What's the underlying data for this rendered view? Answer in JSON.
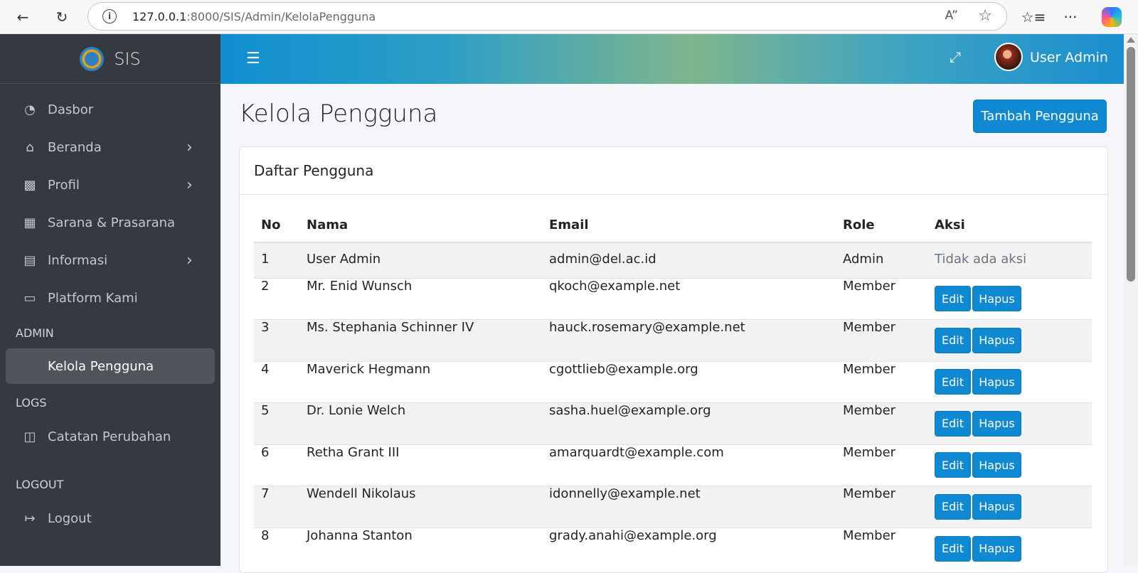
{
  "browser": {
    "url_host": "127.0.0.1",
    "url_path": ":8000/SIS/Admin/KelolaPengguna"
  },
  "sidebar": {
    "brand": "SIS",
    "items": [
      {
        "label": "Dasbor",
        "icon": "gauge-icon"
      },
      {
        "label": "Beranda",
        "icon": "home-icon"
      },
      {
        "label": "Profil",
        "icon": "contact-card-icon"
      },
      {
        "label": "Sarana & Prasarana",
        "icon": "building-icon"
      },
      {
        "label": "Informasi",
        "icon": "document-list-icon"
      },
      {
        "label": "Platform Kami",
        "icon": "monitor-icon"
      }
    ],
    "header_admin": "ADMIN",
    "admin_item": "Kelola Pengguna",
    "header_logs": "LOGS",
    "logs_item": "Catatan Perubahan",
    "header_logout": "LOGOUT",
    "logout_item": "Logout"
  },
  "header": {
    "user_name": "User Admin"
  },
  "page": {
    "title": "Kelola Pengguna",
    "add_button": "Tambah Pengguna",
    "card_title": "Daftar Pengguna"
  },
  "table": {
    "columns": [
      "No",
      "Nama",
      "Email",
      "Role",
      "Aksi"
    ],
    "no_action_text": "Tidak ada aksi",
    "edit_label": "Edit",
    "delete_label": "Hapus",
    "rows": [
      {
        "no": "1",
        "name": "User Admin",
        "email": "admin@del.ac.id",
        "role": "Admin"
      },
      {
        "no": "2",
        "name": "Mr. Enid Wunsch",
        "email": "qkoch@example.net",
        "role": "Member"
      },
      {
        "no": "3",
        "name": "Ms. Stephania Schinner IV",
        "email": "hauck.rosemary@example.net",
        "role": "Member"
      },
      {
        "no": "4",
        "name": "Maverick Hegmann",
        "email": "cgottlieb@example.org",
        "role": "Member"
      },
      {
        "no": "5",
        "name": "Dr. Lonie Welch",
        "email": "sasha.huel@example.org",
        "role": "Member"
      },
      {
        "no": "6",
        "name": "Retha Grant III",
        "email": "amarquardt@example.com",
        "role": "Member"
      },
      {
        "no": "7",
        "name": "Wendell Nikolaus",
        "email": "idonnelly@example.net",
        "role": "Member"
      },
      {
        "no": "8",
        "name": "Johanna Stanton",
        "email": "grady.anahi@example.org",
        "role": "Member"
      }
    ]
  }
}
